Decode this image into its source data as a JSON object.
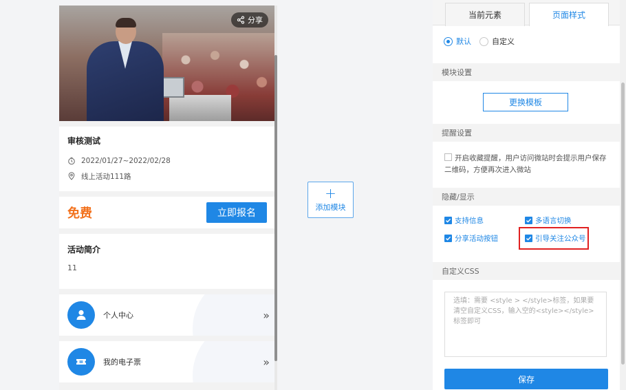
{
  "preview": {
    "share_label": "分享",
    "event_title": "审核测试",
    "event_date": "2022/01/27~2022/02/28",
    "event_location": "线上活动111路",
    "price_label": "免费",
    "signup_label": "立即报名",
    "intro_heading": "活动简介",
    "intro_text": "11",
    "menu": [
      {
        "label": "个人中心",
        "icon": "user-icon"
      },
      {
        "label": "我的电子票",
        "icon": "ticket-icon"
      }
    ],
    "arrow_glyph": "»"
  },
  "add_module": {
    "plus": "+",
    "label": "添加模块"
  },
  "panel": {
    "tabs": [
      "当前元素",
      "页面样式"
    ],
    "active_tab": 1,
    "style_options": [
      "默认",
      "自定义"
    ],
    "selected_style": "默认",
    "section_module": "模块设置",
    "replace_template_label": "更换模板",
    "section_remind": "提醒设置",
    "remind_text": "开启收藏提醒，用户访问微站时会提示用户保存二维码，方便再次进入微站",
    "section_visibility": "隐藏/显示",
    "checkboxes": [
      {
        "label": "支持信息",
        "checked": true
      },
      {
        "label": "多语言切换",
        "checked": true
      },
      {
        "label": "分享活动按钮",
        "checked": true
      },
      {
        "label": "引导关注公众号",
        "checked": true
      }
    ],
    "section_css": "自定义CSS",
    "css_placeholder": "选填：需要 <style > </style>标签，如果要清空自定义CSS，输入空的<style></style>标签即可",
    "save_label": "保存"
  },
  "colors": {
    "accent": "#1f87e5",
    "price": "#f2711c",
    "highlight": "#e02020"
  }
}
